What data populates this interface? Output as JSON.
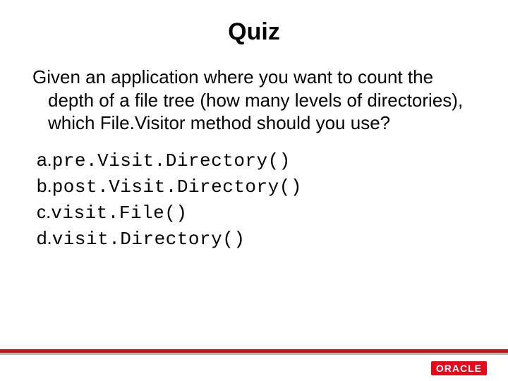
{
  "title": "Quiz",
  "question": "Given an application where you want to count the depth of a file tree (how many levels of directories), which File.Visitor method should you use?",
  "options": [
    {
      "letter": "a.",
      "code": "pre.Visit.Directory()"
    },
    {
      "letter": "b.",
      "code": "post.Visit.Directory()"
    },
    {
      "letter": "c.",
      "code": "visit.File()"
    },
    {
      "letter": "d.",
      "code": "visit.Directory()"
    }
  ],
  "brand": "ORACLE"
}
